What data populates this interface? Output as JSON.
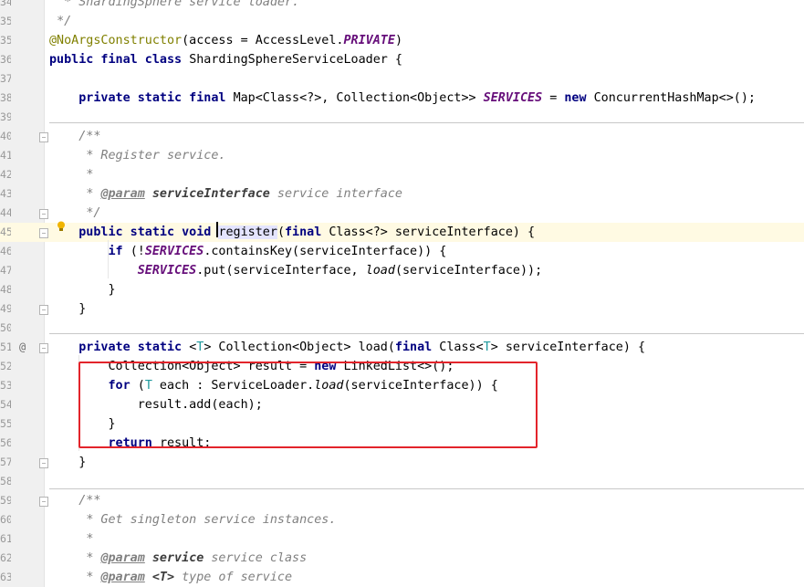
{
  "editor": {
    "file_class": "ShardingSphereServiceLoader",
    "lines": [
      {
        "n": "34",
        "segs": [
          {
            "t": "  "
          },
          {
            "t": "* ShardingSphere service loader.",
            "c": "cmt"
          }
        ]
      },
      {
        "n": "35",
        "segs": [
          {
            "t": " "
          },
          {
            "t": "*/",
            "c": "cmt"
          }
        ]
      },
      {
        "n": "35",
        "segs": [
          {
            "t": "@NoArgsConstructor",
            "c": "ann"
          },
          {
            "t": "(access = AccessLevel."
          },
          {
            "t": "PRIVATE",
            "c": "fld"
          },
          {
            "t": ")"
          }
        ]
      },
      {
        "n": "36",
        "segs": [
          {
            "t": "public final class ",
            "c": "kw"
          },
          {
            "t": "ShardingSphereServiceLoader {"
          }
        ]
      },
      {
        "n": "37",
        "segs": []
      },
      {
        "n": "38",
        "segs": [
          {
            "t": "    "
          },
          {
            "t": "private static final ",
            "c": "kw"
          },
          {
            "t": "Map<Class<?>, Collection<Object>> "
          },
          {
            "t": "SERVICES",
            "c": "fld"
          },
          {
            "t": " = "
          },
          {
            "t": "new ",
            "c": "kw"
          },
          {
            "t": "ConcurrentHashMap<>();"
          }
        ]
      },
      {
        "n": "39",
        "segs": []
      },
      {
        "n": "40",
        "segs": [
          {
            "t": "    "
          },
          {
            "t": "/**",
            "c": "cmt"
          }
        ]
      },
      {
        "n": "41",
        "segs": [
          {
            "t": "     "
          },
          {
            "t": "* Register service.",
            "c": "cmt"
          }
        ]
      },
      {
        "n": "42",
        "segs": [
          {
            "t": "     "
          },
          {
            "t": "*",
            "c": "cmt"
          }
        ]
      },
      {
        "n": "43",
        "segs": [
          {
            "t": "     "
          },
          {
            "t": "* ",
            "c": "cmt"
          },
          {
            "t": "@param",
            "c": "tag"
          },
          {
            "t": " ",
            "c": "cmt"
          },
          {
            "t": "serviceInterface",
            "c": "tagname"
          },
          {
            "t": " service interface",
            "c": "cmt"
          }
        ]
      },
      {
        "n": "44",
        "segs": [
          {
            "t": "     "
          },
          {
            "t": "*/",
            "c": "cmt"
          }
        ]
      },
      {
        "n": "45",
        "segs": [
          {
            "t": "    "
          },
          {
            "t": "public static void ",
            "c": "kw"
          },
          {
            "t": "register",
            "c": "ref"
          },
          {
            "t": "("
          },
          {
            "t": "final ",
            "c": "kw"
          },
          {
            "t": "Class<?> serviceInterface) {"
          }
        ]
      },
      {
        "n": "46",
        "segs": [
          {
            "t": "        "
          },
          {
            "t": "if ",
            "c": "kw"
          },
          {
            "t": "(!"
          },
          {
            "t": "SERVICES",
            "c": "fld"
          },
          {
            "t": ".containsKey(serviceInterface)) {"
          }
        ]
      },
      {
        "n": "47",
        "segs": [
          {
            "t": "            "
          },
          {
            "t": "SERVICES",
            "c": "fld"
          },
          {
            "t": ".put(serviceInterface, "
          },
          {
            "t": "load",
            "c": "stc"
          },
          {
            "t": "(serviceInterface));"
          }
        ]
      },
      {
        "n": "48",
        "segs": [
          {
            "t": "        }"
          }
        ]
      },
      {
        "n": "49",
        "segs": [
          {
            "t": "    }"
          }
        ]
      },
      {
        "n": "50",
        "segs": []
      },
      {
        "n": "51",
        "segs": [
          {
            "t": "    "
          },
          {
            "t": "private static ",
            "c": "kw"
          },
          {
            "t": "<"
          },
          {
            "t": "T",
            "c": "tp"
          },
          {
            "t": "> Collection<Object> load("
          },
          {
            "t": "final ",
            "c": "kw"
          },
          {
            "t": "Class<"
          },
          {
            "t": "T",
            "c": "tp"
          },
          {
            "t": "> serviceInterface) {"
          }
        ]
      },
      {
        "n": "52",
        "segs": [
          {
            "t": "        Collection<Object> result = "
          },
          {
            "t": "new ",
            "c": "kw"
          },
          {
            "t": "LinkedList<>();"
          }
        ]
      },
      {
        "n": "53",
        "segs": [
          {
            "t": "        "
          },
          {
            "t": "for ",
            "c": "kw"
          },
          {
            "t": "("
          },
          {
            "t": "T",
            "c": "tp"
          },
          {
            "t": " each : ServiceLoader."
          },
          {
            "t": "load",
            "c": "stc"
          },
          {
            "t": "(serviceInterface)) {"
          }
        ]
      },
      {
        "n": "54",
        "segs": [
          {
            "t": "            result.add(each);"
          }
        ]
      },
      {
        "n": "55",
        "segs": [
          {
            "t": "        }"
          }
        ]
      },
      {
        "n": "56",
        "segs": [
          {
            "t": "        "
          },
          {
            "t": "return ",
            "c": "kw"
          },
          {
            "t": "result;"
          }
        ]
      },
      {
        "n": "57",
        "segs": [
          {
            "t": "    }"
          }
        ]
      },
      {
        "n": "58",
        "segs": []
      },
      {
        "n": "59",
        "segs": [
          {
            "t": "    "
          },
          {
            "t": "/**",
            "c": "cmt"
          }
        ]
      },
      {
        "n": "60",
        "segs": [
          {
            "t": "     "
          },
          {
            "t": "* Get singleton service instances.",
            "c": "cmt"
          }
        ]
      },
      {
        "n": "61",
        "segs": [
          {
            "t": "     "
          },
          {
            "t": "*",
            "c": "cmt"
          }
        ]
      },
      {
        "n": "62",
        "segs": [
          {
            "t": "     "
          },
          {
            "t": "* ",
            "c": "cmt"
          },
          {
            "t": "@param",
            "c": "tag"
          },
          {
            "t": " ",
            "c": "cmt"
          },
          {
            "t": "service",
            "c": "tagname"
          },
          {
            "t": " service class",
            "c": "cmt"
          }
        ]
      },
      {
        "n": "63",
        "segs": [
          {
            "t": "     "
          },
          {
            "t": "* ",
            "c": "cmt"
          },
          {
            "t": "@param",
            "c": "tag"
          },
          {
            "t": " ",
            "c": "cmt"
          },
          {
            "t": "<T>",
            "c": "tagname"
          },
          {
            "t": " type of service",
            "c": "cmt"
          }
        ]
      }
    ],
    "caret_line_number": "45",
    "override_marker": "@",
    "intention_icon": "lightbulb-icon",
    "highlight_color": "#e3242b"
  }
}
